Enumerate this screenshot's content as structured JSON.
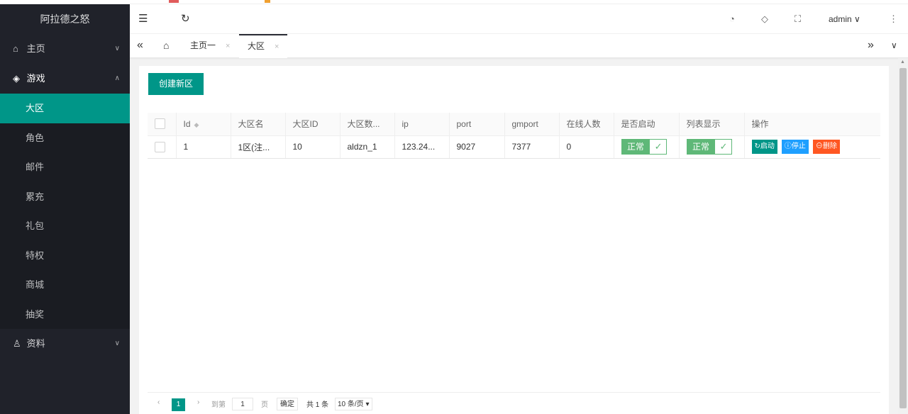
{
  "app": {
    "title": "阿拉德之怒"
  },
  "sidebar": {
    "groups": [
      {
        "label": "主页",
        "icon": "home-icon",
        "chevron": "∨"
      },
      {
        "label": "游戏",
        "icon": "diamond-icon",
        "chevron": "∧"
      },
      {
        "label": "资料",
        "icon": "user-icon",
        "chevron": "∨"
      }
    ],
    "game_items": [
      {
        "label": "大区",
        "active": true
      },
      {
        "label": "角色"
      },
      {
        "label": "邮件"
      },
      {
        "label": "累充"
      },
      {
        "label": "礼包"
      },
      {
        "label": "特权"
      },
      {
        "label": "商城"
      },
      {
        "label": "抽奖"
      }
    ]
  },
  "header": {
    "user": "admin"
  },
  "tabs": {
    "items": [
      {
        "label": "主页一",
        "close": "×"
      },
      {
        "label": "大区",
        "close": "×",
        "active": true
      }
    ]
  },
  "main": {
    "create_button": "创建新区",
    "table": {
      "columns": [
        "Id",
        "大区名",
        "大区ID",
        "大区数...",
        "ip",
        "port",
        "gmport",
        "在线人数",
        "是否启动",
        "列表显示",
        "操作"
      ],
      "rows": [
        {
          "id": "1",
          "name": "1区(注...",
          "zone_id": "10",
          "db": "aldzn_1",
          "ip": "123.24...",
          "port": "9027",
          "gmport": "7377",
          "online": "0",
          "started": "正常",
          "list_show": "正常"
        }
      ],
      "actions": {
        "start": "启动",
        "stop": "停止",
        "delete": "删除"
      }
    },
    "pager": {
      "current": "1",
      "goto_label": "到第",
      "goto_value": "1",
      "page_unit": "页",
      "confirm": "确定",
      "total": "共 1 条",
      "page_size": "10 条/页"
    }
  },
  "colors": {
    "sidebar_bg": "#20222a",
    "accent": "#009688",
    "switch_green": "#5fb878",
    "stop_blue": "#1e9fff",
    "delete_orange": "#ff5722"
  }
}
